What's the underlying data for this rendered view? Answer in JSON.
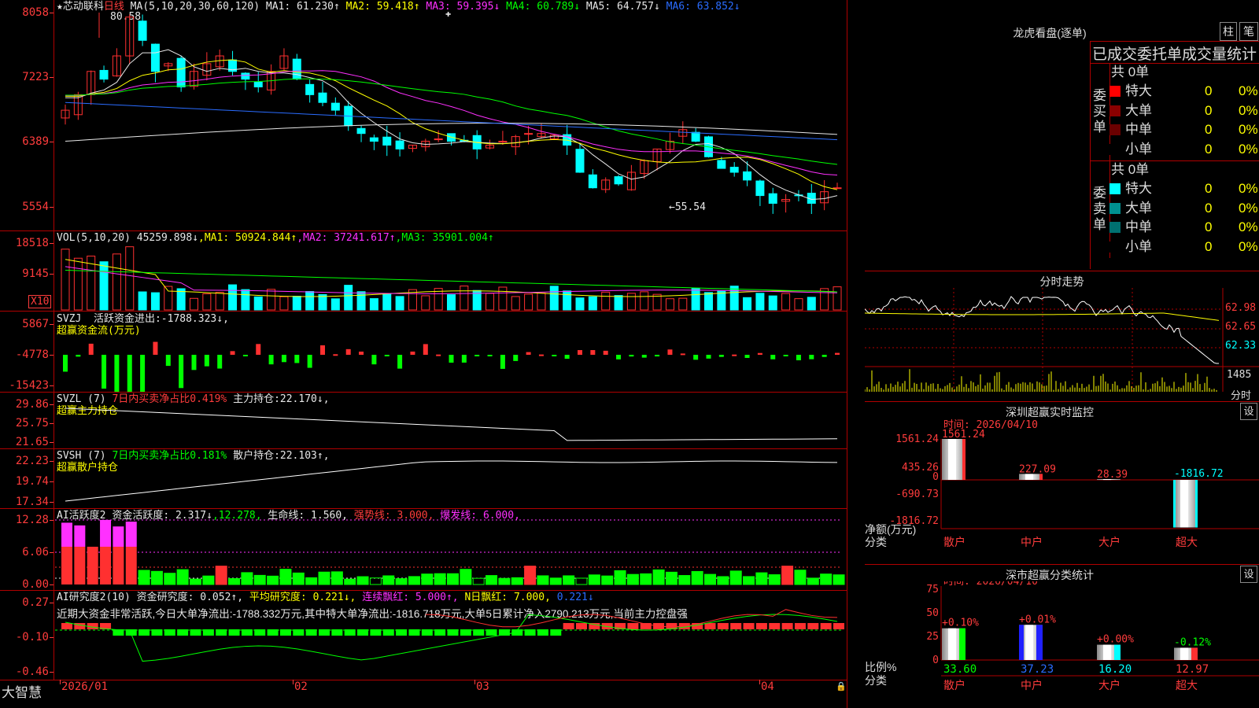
{
  "stock": {
    "name": "★芯动联科",
    "period": "日线"
  },
  "kline": {
    "ma_label": "MA(5,10,20,30,60,120)",
    "ma_items": [
      {
        "label": "MA1:",
        "value": "61.230",
        "arrow": "↑",
        "color": "#e8e8e8"
      },
      {
        "label": "MA2:",
        "value": "59.418",
        "arrow": "↑",
        "color": "#ffff00"
      },
      {
        "label": "MA3:",
        "value": "59.395",
        "arrow": "↓",
        "color": "#ff30ff"
      },
      {
        "label": "MA4:",
        "value": "60.789",
        "arrow": "↓",
        "color": "#00ff00"
      },
      {
        "label": "MA5:",
        "value": "64.757",
        "arrow": "↓",
        "color": "#e8e8e8"
      },
      {
        "label": "MA6:",
        "value": "63.852",
        "arrow": "↓",
        "color": "#2a6cff"
      }
    ],
    "y_labels": [
      "8058",
      "7223",
      "6389",
      "5554"
    ],
    "high_note": "80.58",
    "low_note": "←55.54",
    "ylim": [
      51.5,
      82
    ]
  },
  "vol": {
    "header": "VOL(5,10,20)",
    "value": "45259.898↓",
    "items": [
      {
        "label": "MA1:",
        "value": "50924.844↑",
        "color": "#ffff00"
      },
      {
        "label": "MA2:",
        "value": "37241.617↑",
        "color": "#ff30ff"
      },
      {
        "label": "MA3:",
        "value": "35901.004↑",
        "color": "#00ff00"
      }
    ],
    "y_labels": [
      "18518",
      "9145"
    ],
    "unit": "X10"
  },
  "svzj": {
    "name": "SVZJ",
    "label": "活跃资金进出:",
    "value": "-1788.323↓,",
    "sub": "超赢资金流(万元)",
    "y_labels": [
      "5867",
      "-4778",
      "-15423"
    ]
  },
  "svzl": {
    "name": "SVZL (7)",
    "t1": "7日内买卖净占比0.419%",
    "label": "主力持仓:",
    "value": "22.170↓,",
    "sub": "超赢主力持仓",
    "y_labels": [
      "29.86",
      "25.75",
      "21.65"
    ]
  },
  "svsh": {
    "name": "SVSH (7)",
    "t1": "7日内买卖净占比0.181%",
    "label": "散户持仓:",
    "value": "22.103↑,",
    "sub": "超赢散户持仓",
    "y_labels": [
      "22.23",
      "19.74",
      "17.34"
    ]
  },
  "ai1": {
    "name": "AI活跃度2",
    "t1": "资金活跃度:",
    "v1": "2.317↓",
    "v2": ",12.278,",
    "t2": "生命线:",
    "v3": "1.560,",
    "t3": "强势线:",
    "v4": "3.000,",
    "t4": "爆发线:",
    "v5": "6.000,",
    "y_labels": [
      "12.28",
      "6.06",
      "0.00"
    ]
  },
  "ai2": {
    "name": "AI研究度2(10)",
    "t1": "资金研究度:",
    "v1": "0.052↑,",
    "t2": "平均研究度:",
    "v2": "0.221↓,",
    "t3": "连续飘红:",
    "v3": "5.000↑,",
    "t4": "N日飘红:",
    "v4": "7.000,",
    "v5": "0.221↓",
    "note": "近期大资金非常活跃,今日大单净流出:-1788.332万元,其中特大单净流出:-1816.718万元,大单5日累计净入2790.213万元,当前主力控盘强",
    "y_labels": [
      "0.27",
      "-0.10",
      "-0.46"
    ]
  },
  "xaxis": {
    "labels": [
      "2026/01",
      "02",
      "03",
      "04"
    ]
  },
  "brand": "大智慧",
  "right": {
    "title": "龙虎看盘(逐单)",
    "btn1": "柱",
    "btn2": "笔",
    "table_title": "已成交委托单成交量统计",
    "buy": {
      "side": "委买单",
      "total": "共 0单",
      "rows": [
        {
          "label": "特大",
          "color": "#ff0000",
          "v1": "0",
          "v2": "0%"
        },
        {
          "label": "大单",
          "color": "#8b0000",
          "v1": "0",
          "v2": "0%"
        },
        {
          "label": "中单",
          "color": "#6b0000",
          "v1": "0",
          "v2": "0%"
        },
        {
          "label": "小单",
          "color": "#000000",
          "v1": "0",
          "v2": "0%"
        }
      ]
    },
    "sell": {
      "side": "委卖单",
      "total": "共 0单",
      "rows": [
        {
          "label": "特大",
          "color": "#00ffff",
          "v1": "0",
          "v2": "0%"
        },
        {
          "label": "大单",
          "color": "#009090",
          "v1": "0",
          "v2": "0%"
        },
        {
          "label": "中单",
          "color": "#007070",
          "v1": "0",
          "v2": "0%"
        },
        {
          "label": "小单",
          "color": "#000000",
          "v1": "0",
          "v2": "0%"
        }
      ]
    },
    "intraday": {
      "title": "分时走势",
      "y_labels": [
        "62.98",
        "62.65",
        "62.33"
      ],
      "vol_label": "1485",
      "foot": "分时"
    },
    "sz_monitor": {
      "title": "深圳超赢实时监控",
      "set": "设",
      "date": "时间: 2026/04/10",
      "y_labels": [
        "1561.24",
        "435.26",
        "0",
        "-690.73",
        "-1816.72"
      ],
      "ylabel1": "净额(万元)",
      "ylabel2": "分类",
      "cats": [
        "散户",
        "中户",
        "大户",
        "超大"
      ],
      "values": [
        1561.24,
        227.09,
        28.39,
        -1816.72
      ],
      "value_labels": [
        "1561.24",
        "227.09",
        "28.39",
        "-1816.72"
      ]
    },
    "sz_class": {
      "title": "深市超赢分类统计",
      "set": "设",
      "date": "时间: 2026/04/10",
      "y_labels": [
        "75",
        "50",
        "25",
        "0"
      ],
      "ylabel1": "比例%",
      "ylabel2": "分类",
      "cats": [
        "散户",
        "中户",
        "大户",
        "超大"
      ],
      "values": [
        33.6,
        37.23,
        16.2,
        12.97
      ],
      "value_labels": [
        "33.60",
        "37.23",
        "16.20",
        "12.97"
      ],
      "changes": [
        "+0.10%",
        "+0.01%",
        "+0.00%",
        "-0.12%"
      ],
      "colors": [
        "#00ff00",
        "#2020ff",
        "#00ffff",
        "#ff3030"
      ]
    }
  }
}
